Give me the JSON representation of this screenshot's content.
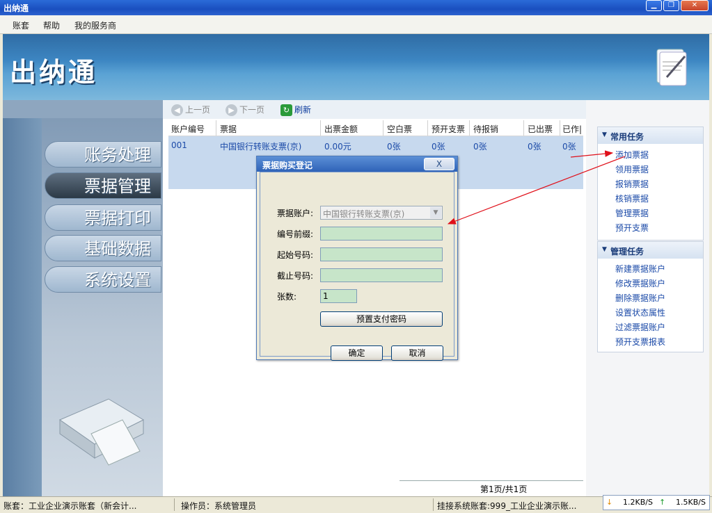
{
  "window": {
    "title": "出纳通"
  },
  "menu": [
    "账套",
    "帮助",
    "我的服务商"
  ],
  "banner": {
    "logo": "出纳通"
  },
  "sidebar": {
    "items": [
      {
        "label": "账务处理",
        "active": false
      },
      {
        "label": "票据管理",
        "active": true
      },
      {
        "label": "票据打印",
        "active": false
      },
      {
        "label": "基础数据",
        "active": false
      },
      {
        "label": "系统设置",
        "active": false
      }
    ]
  },
  "toolbar": {
    "prev": "上一页",
    "next": "下一页",
    "refresh": "刷新"
  },
  "grid": {
    "columns": [
      "账户编号",
      "票据",
      "出票金额",
      "空白票",
      "预开支票",
      "待报销",
      "已出票",
      "已作|"
    ],
    "rows": [
      [
        "001",
        "中国银行转账支票(京)",
        "0.00元",
        "0张",
        "0张",
        "0张",
        "0张",
        "0张"
      ]
    ]
  },
  "pager": "第1页/共1页",
  "tasks": {
    "common": {
      "title": "常用任务",
      "items": [
        "添加票据",
        "领用票据",
        "报销票据",
        "核销票据",
        "管理票据",
        "预开支票"
      ]
    },
    "manage": {
      "title": "管理任务",
      "items": [
        "新建票据账户",
        "修改票据账户",
        "删除票据账户",
        "设置状态属性",
        "过滤票据账户",
        "预开支票报表"
      ]
    }
  },
  "dialog": {
    "title": "票据购买登记",
    "close": "X",
    "fields": {
      "account_label": "票据账户:",
      "account_value": "中国银行转账支票(京)",
      "prefix_label": "编号前缀:",
      "prefix_value": "",
      "start_label": "起始号码:",
      "start_value": "",
      "end_label": "截止号码:",
      "end_value": "",
      "count_label": "张数:",
      "count_value": "1"
    },
    "preset_button": "预置支付密码",
    "ok": "确定",
    "cancel": "取消"
  },
  "status": {
    "account": "账套：工业企业演示账套（新会计...",
    "operator": "操作员：系统管理员",
    "linked": "挂接系统账套:999_工业企业演示账..."
  },
  "net": {
    "down": "1.2KB/S",
    "up": "1.5KB/S"
  },
  "colors": {
    "annotation_arrow": "#e0101a",
    "selected_row": "#c7d9ee",
    "input_bg": "#c7e5c9"
  }
}
